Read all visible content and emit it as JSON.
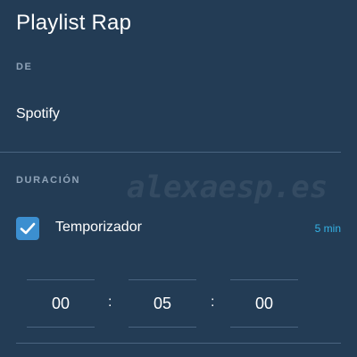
{
  "header": {
    "title": "Playlist Rap"
  },
  "source": {
    "section_label": "DE",
    "value": "Spotify"
  },
  "duration": {
    "section_label": "DURACIÓN",
    "timer_checkbox_checked": true,
    "timer_label": "Temporizador",
    "timer_summary": "5 min",
    "hours": "00",
    "minutes": "05",
    "seconds": "00",
    "separator": ":"
  },
  "watermark": "alexaesp.es",
  "colors": {
    "background": "#233c55",
    "accent": "#3c8fd0",
    "summary_text": "#35b3e6",
    "section_label": "#8fa3b8",
    "divider": "#4a6480"
  },
  "icons": {
    "checkbox_mark": "check-icon"
  }
}
